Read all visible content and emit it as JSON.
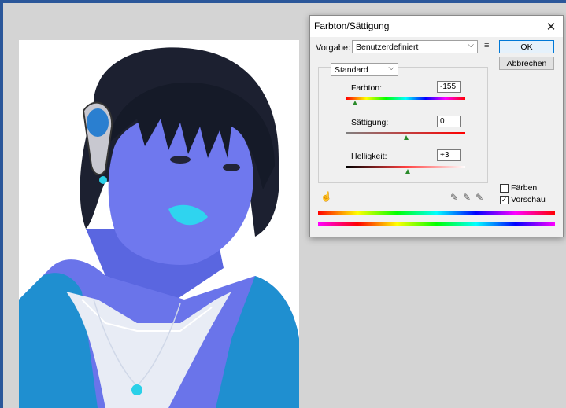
{
  "dialog": {
    "title": "Farbton/Sättigung",
    "close_symbol": "✕",
    "preset_label": "Vorgabe:",
    "preset_value": "Benutzerdefiniert",
    "ok_label": "OK",
    "cancel_label": "Abbrechen",
    "channel_value": "Standard",
    "hue": {
      "label": "Farbton:",
      "value": "-155",
      "level": 0.07
    },
    "saturation": {
      "label": "Sättigung:",
      "value": "0",
      "level": 0.5
    },
    "lightness": {
      "label": "Helligkeit:",
      "value": "+3",
      "level": 0.515
    },
    "colorize": {
      "label": "Färben",
      "checked": false
    },
    "preview": {
      "label": "Vorschau",
      "checked": true
    },
    "icons": {
      "close": "close-icon",
      "preset_menu": "preset-options-icon",
      "hand": "target-adjust-icon",
      "eyedroppers": "eyedropper-icons"
    }
  },
  "colors": {
    "desktop_bg": "#2b579a",
    "canvas_bg": "#d4d4d4",
    "ok_border": "#0078d7",
    "thumb": "#2a8a2a"
  }
}
